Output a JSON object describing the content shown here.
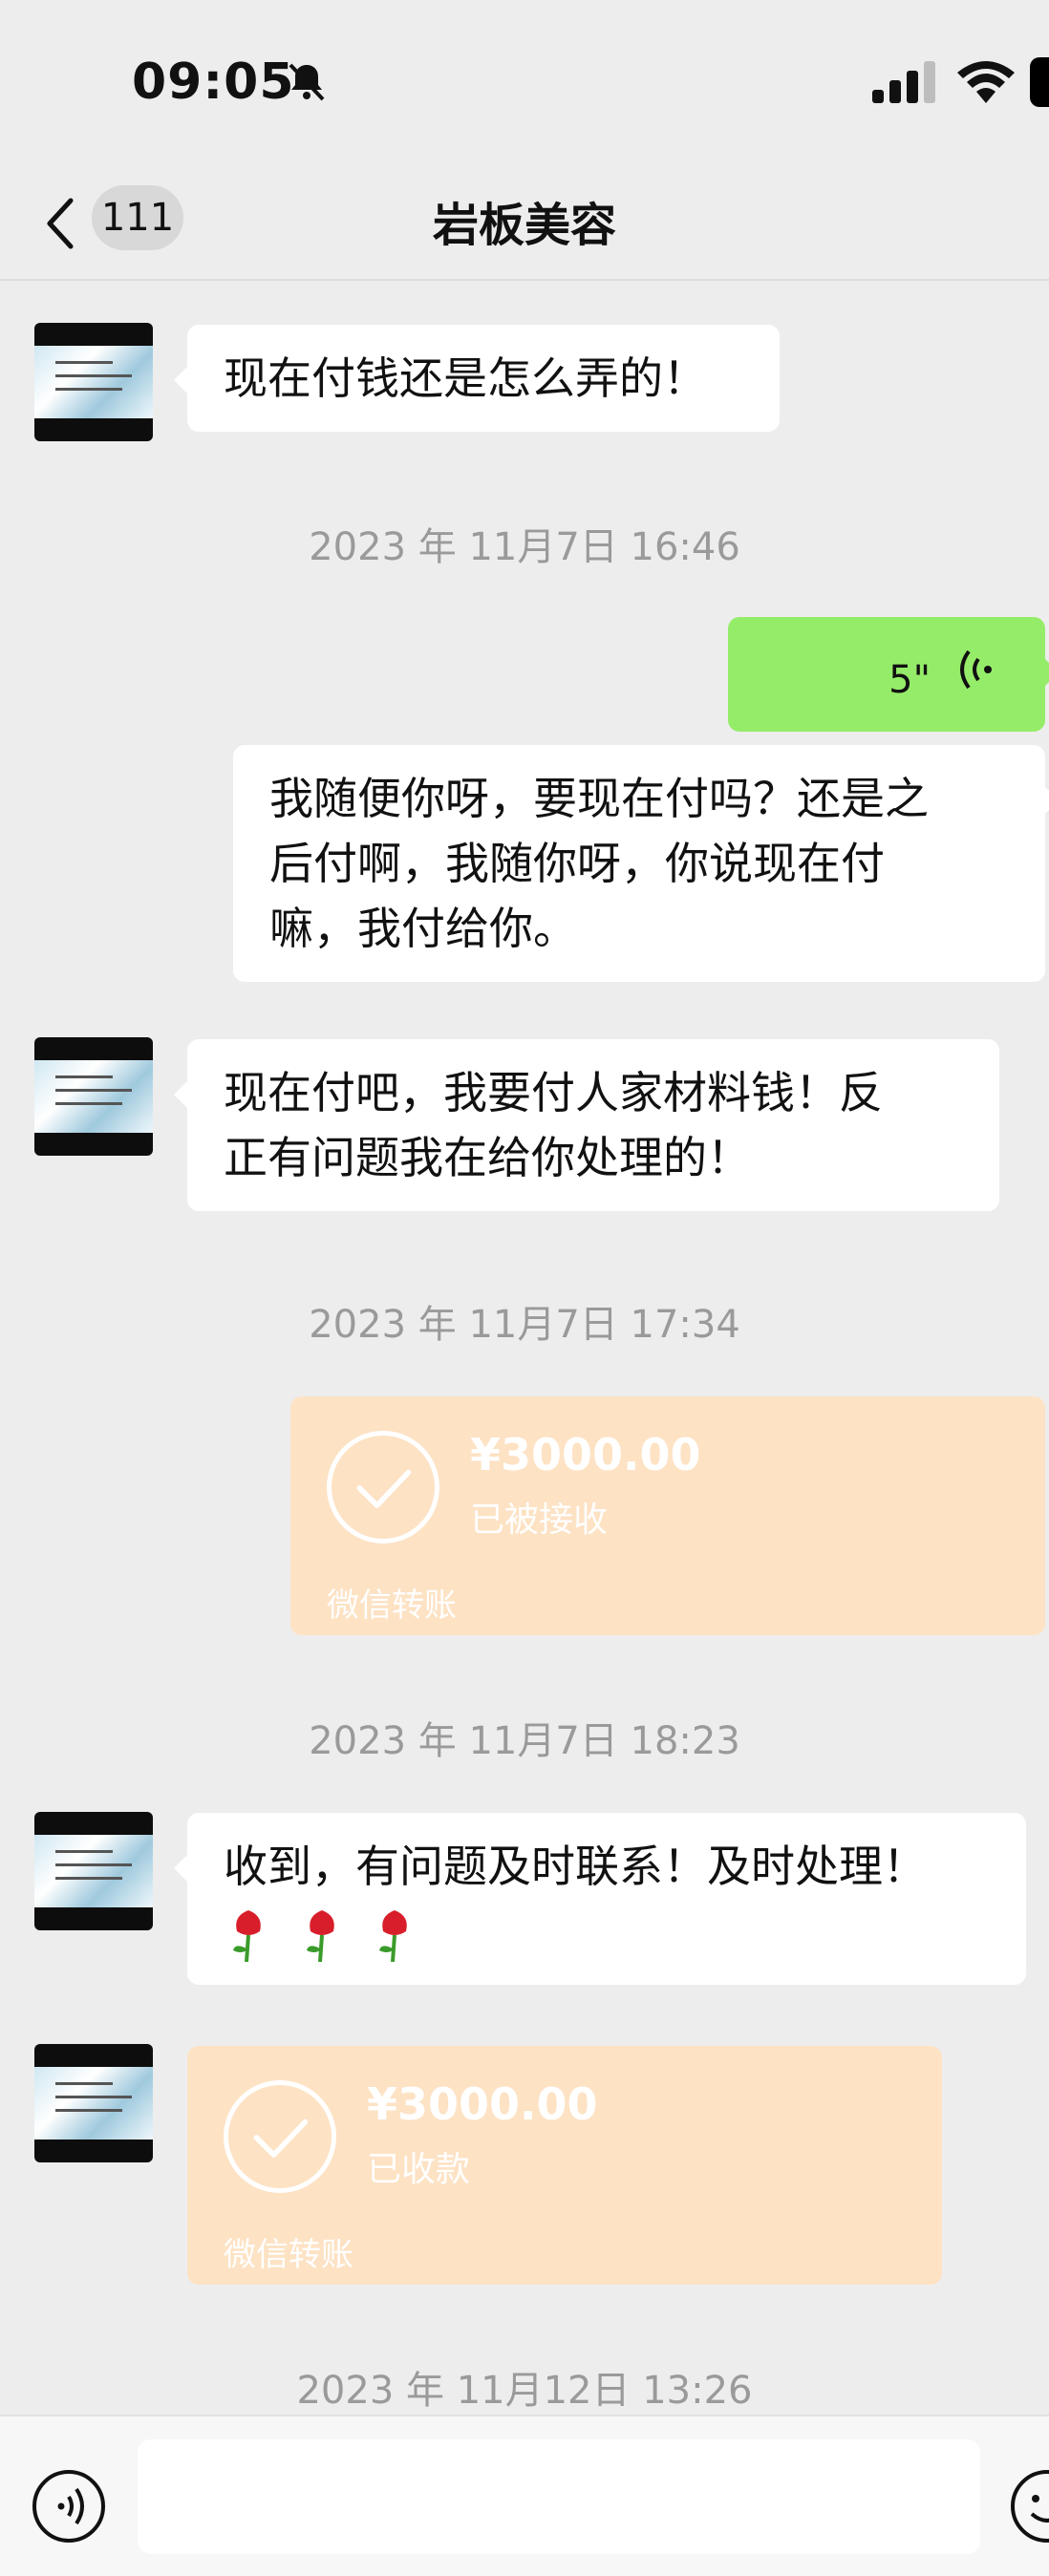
{
  "status_bar": {
    "time": "09:05",
    "icons": [
      "bell-muted-icon",
      "signal-icon",
      "wifi-icon",
      "battery-icon"
    ]
  },
  "nav": {
    "back_icon": "chevron-left-icon",
    "unread_count": "111",
    "title": "岩板美容"
  },
  "messages": [
    {
      "type": "text",
      "side": "in",
      "text": "现在付钱还是怎么弄的！"
    },
    {
      "type": "timestamp",
      "text": "2023 年 11月7日 16:46"
    },
    {
      "type": "voice",
      "side": "out",
      "duration": "5\""
    },
    {
      "type": "text",
      "side": "out",
      "lines": [
        "我随便你呀，要现在付吗？还是之",
        "后付啊，我随你呀，你说现在付",
        "嘛，我付给你。"
      ]
    },
    {
      "type": "text",
      "side": "in",
      "lines": [
        "现在付吧，我要付人家材料钱！反",
        "正有问题我在给你处理的！"
      ]
    },
    {
      "type": "timestamp",
      "text": "2023 年 11月7日 17:34"
    },
    {
      "type": "transfer",
      "side": "out",
      "amount": "¥3000.00",
      "status": "已被接收",
      "brand": "微信转账"
    },
    {
      "type": "timestamp",
      "text": "2023 年 11月7日 18:23"
    },
    {
      "type": "text",
      "side": "in",
      "text": "收到，有问题及时联系！及时处理！",
      "emoji": [
        "rose-icon",
        "rose-icon",
        "rose-icon"
      ]
    },
    {
      "type": "transfer",
      "side": "in",
      "amount": "¥3000.00",
      "status": "已收款",
      "brand": "微信转账"
    },
    {
      "type": "timestamp",
      "text": "2023 年 11月12日 13:26"
    }
  ],
  "input_bar": {
    "voice_icon": "voice-input-icon",
    "input_value": "",
    "emoji_icon": "emoji-icon"
  },
  "colors": {
    "background": "#ededed",
    "green_bubble": "#95ec69",
    "transfer_card": "#fde2c4",
    "timestamp": "#9a9a9a"
  }
}
